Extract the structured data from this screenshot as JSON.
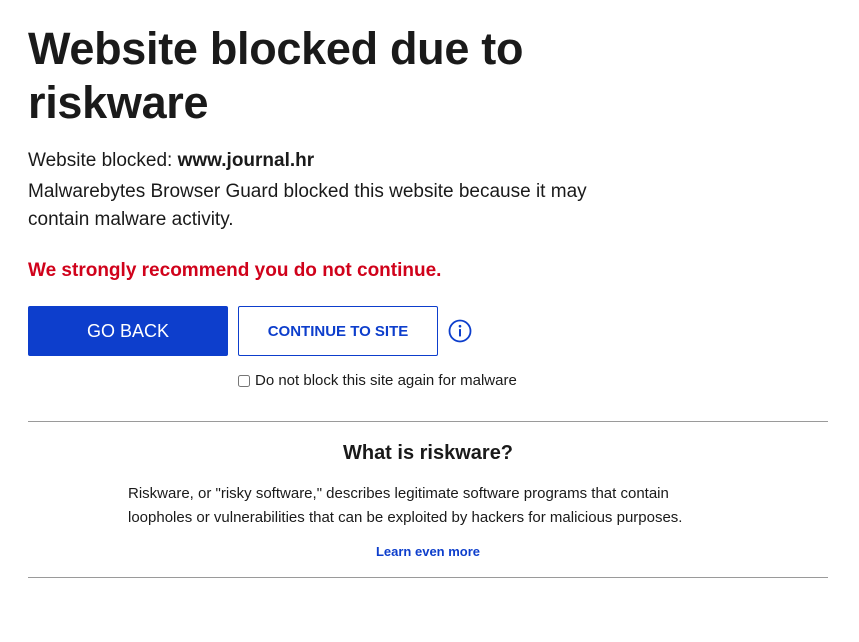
{
  "page": {
    "title": "Website blocked due to riskware",
    "blocked_prefix": "Website blocked: ",
    "blocked_url": "www.journal.hr",
    "description": "Malwarebytes Browser Guard blocked this website because it may contain malware activity.",
    "warning": "We strongly recommend you do not continue.",
    "warning_color": "#d0021b",
    "accent_color": "#0d3ecc"
  },
  "actions": {
    "go_back_label": "GO BACK",
    "continue_label": "CONTINUE TO SITE",
    "info_icon": "info-icon",
    "checkbox_label": "Do not block this site again for malware",
    "checkbox_checked": false
  },
  "info_section": {
    "title": "What is riskware?",
    "text": "Riskware, or \"risky software,\" describes legitimate software programs that contain loopholes or vulnerabilities that can be exploited by hackers for malicious purposes.",
    "link_label": "Learn even more"
  }
}
